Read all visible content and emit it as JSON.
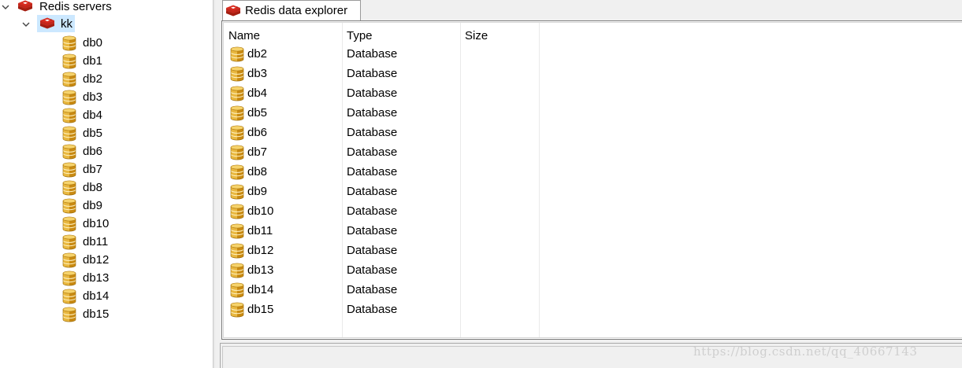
{
  "tree": {
    "root": {
      "label": "Redis servers",
      "icon": "redis-icon",
      "expanded": true
    },
    "server": {
      "label": "kk",
      "icon": "redis-icon",
      "expanded": true,
      "selected": true
    },
    "databases": [
      "db0",
      "db1",
      "db2",
      "db3",
      "db4",
      "db5",
      "db6",
      "db7",
      "db8",
      "db9",
      "db10",
      "db11",
      "db12",
      "db13",
      "db14",
      "db15"
    ]
  },
  "explorer": {
    "tab_label": "Redis data explorer",
    "tab_icon": "redis-icon",
    "columns": [
      "Name",
      "Type",
      "Size"
    ],
    "rows": [
      {
        "name": "db2",
        "type": "Database"
      },
      {
        "name": "db3",
        "type": "Database"
      },
      {
        "name": "db4",
        "type": "Database"
      },
      {
        "name": "db5",
        "type": "Database"
      },
      {
        "name": "db6",
        "type": "Database"
      },
      {
        "name": "db7",
        "type": "Database"
      },
      {
        "name": "db8",
        "type": "Database"
      },
      {
        "name": "db9",
        "type": "Database"
      },
      {
        "name": "db10",
        "type": "Database"
      },
      {
        "name": "db11",
        "type": "Database"
      },
      {
        "name": "db12",
        "type": "Database"
      },
      {
        "name": "db13",
        "type": "Database"
      },
      {
        "name": "db14",
        "type": "Database"
      },
      {
        "name": "db15",
        "type": "Database"
      }
    ]
  },
  "watermark": "https://blog.csdn.net/qq_40667143",
  "colors": {
    "selection": "#cce8ff",
    "redis_red": "#d82c20",
    "db_gold": "#e0a526"
  }
}
